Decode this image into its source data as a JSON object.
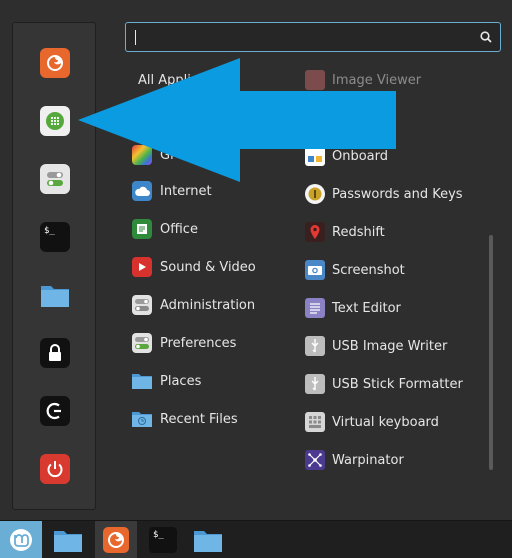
{
  "search": {
    "value": "",
    "placeholder": ""
  },
  "favorites": [
    {
      "name": "firefox-icon",
      "color": "#e8672c"
    },
    {
      "name": "software-manager-icon",
      "color": "#4e9a3a"
    },
    {
      "name": "system-settings-icon",
      "color": "#d9d9d9"
    },
    {
      "name": "terminal-icon",
      "color": "#111111"
    },
    {
      "name": "files-icon",
      "color": "#5aa7de"
    },
    {
      "name": "lock-screen-icon",
      "color": "#111111"
    },
    {
      "name": "logout-icon",
      "color": "#111111"
    },
    {
      "name": "quit-icon",
      "color": "#d83a2f"
    }
  ],
  "categories": [
    {
      "label": "All Applications",
      "icon": "all-applications-icon"
    },
    {
      "label": "Gr",
      "icon": "graphics-icon"
    },
    {
      "label": "Internet",
      "icon": "internet-icon"
    },
    {
      "label": "Office",
      "icon": "office-icon"
    },
    {
      "label": "Sound & Video",
      "icon": "sound-video-icon"
    },
    {
      "label": "Administration",
      "icon": "administration-icon"
    },
    {
      "label": "Preferences",
      "icon": "preferences-icon"
    },
    {
      "label": "Places",
      "icon": "places-icon"
    },
    {
      "label": "Recent Files",
      "icon": "recent-files-icon"
    }
  ],
  "apps": [
    {
      "label": "Image Viewer",
      "icon": "image-viewer-icon"
    },
    {
      "label": "Onboard",
      "icon": "onboard-icon"
    },
    {
      "label": "Passwords and Keys",
      "icon": "passwords-keys-icon"
    },
    {
      "label": "Redshift",
      "icon": "redshift-icon"
    },
    {
      "label": "Screenshot",
      "icon": "screenshot-icon"
    },
    {
      "label": "Text Editor",
      "icon": "text-editor-icon"
    },
    {
      "label": "USB Image Writer",
      "icon": "usb-image-writer-icon"
    },
    {
      "label": "USB Stick Formatter",
      "icon": "usb-stick-formatter-icon"
    },
    {
      "label": "Virtual keyboard",
      "icon": "virtual-keyboard-icon"
    },
    {
      "label": "Warpinator",
      "icon": "warpinator-icon"
    }
  ],
  "terminal_prompt": "$_",
  "colors": {
    "accent": "#6aaed6",
    "arrow": "#0a9be0",
    "background": "#2e2e2e"
  }
}
